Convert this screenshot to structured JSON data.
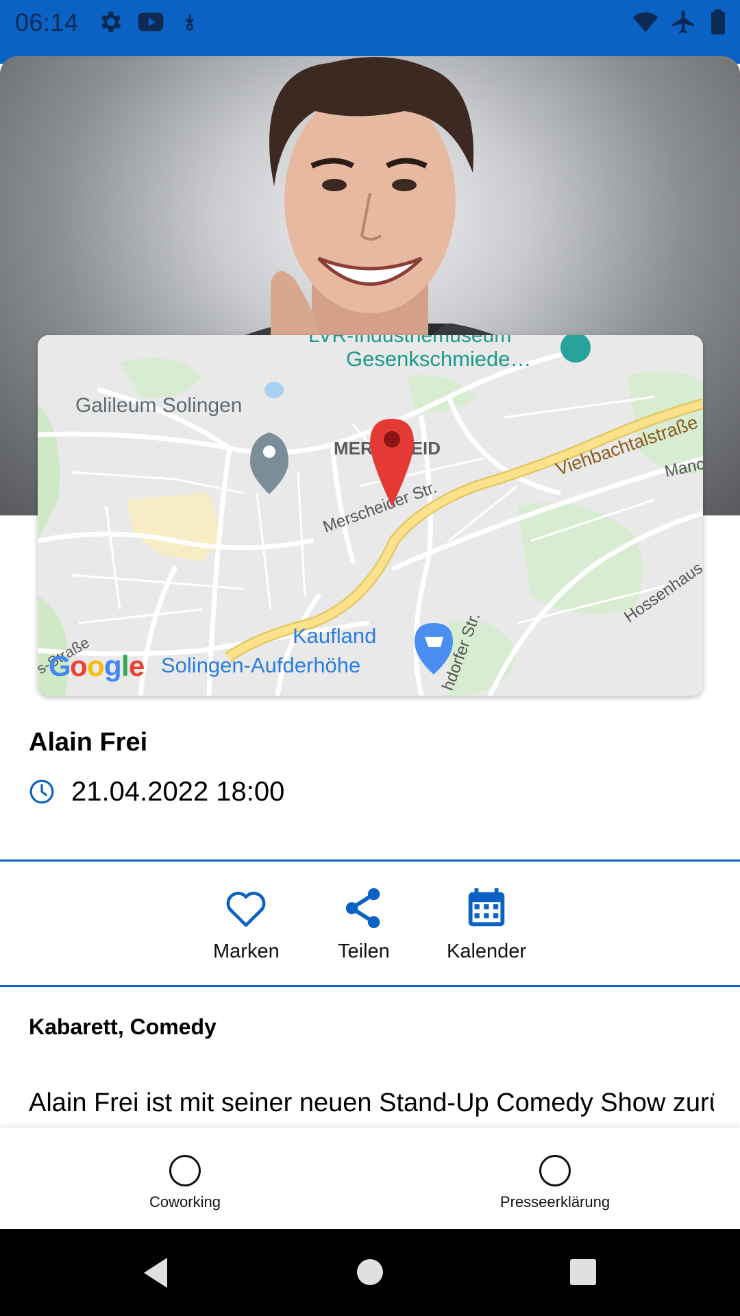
{
  "status_bar": {
    "time": "06:14",
    "left_icons": [
      "settings-icon",
      "youtube-icon",
      "download-icon"
    ],
    "right_icons": [
      "wifi-icon",
      "airplane-icon",
      "battery-icon"
    ],
    "background": "#0a62c4"
  },
  "hero": {
    "description": "Portrait photo of the performer"
  },
  "map": {
    "labels": {
      "museum_top": "LVR-Industriemuseum",
      "museum": "Gesenkschmiede…",
      "galileum": "Galileum Solingen",
      "district": "MERSCHEID",
      "street1": "Merscheider Str.",
      "street2": "Viehbachtalstraße",
      "street3": "Manc",
      "street4": "Hossenhaus",
      "street5": "hdorfer Str.",
      "street6": "s-Straße",
      "kaufland": "Kaufland",
      "aufderhoehe": "Solingen-Aufderhöhe"
    },
    "logo": "Google"
  },
  "event": {
    "title": "Alain Frei",
    "datetime": "21.04.2022 18:00"
  },
  "actions": [
    {
      "label": "Marken",
      "icon": "heart-icon"
    },
    {
      "label": "Teilen",
      "icon": "share-icon"
    },
    {
      "label": "Kalender",
      "icon": "calendar-icon"
    }
  ],
  "categories": "Kabarett, Comedy",
  "description": "Alain Frei ist mit seiner neuen Stand-Up Comedy Show zurück und stellt sich die Frage \"Wer darf Ideen?\"",
  "tabs": [
    {
      "label": "Coworking"
    },
    {
      "label": "Presseerklärung"
    }
  ],
  "colors": {
    "accent": "#0a62c4",
    "pin_red": "#e53935",
    "road_yellow": "#f7d774"
  }
}
